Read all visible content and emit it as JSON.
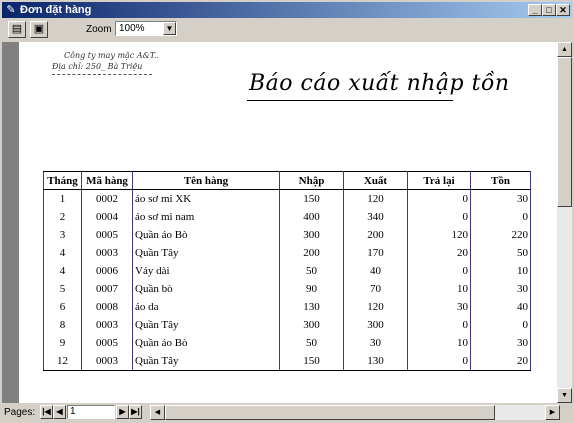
{
  "window": {
    "title": "Đơn đặt hàng",
    "icon": "report-icon"
  },
  "toolbar": {
    "zoom_label": "Zoom",
    "zoom_value": "100%"
  },
  "report": {
    "company": "Công ty may mặc A&T..",
    "address": "Địa chỉ: 250_ Bà Triệu",
    "title": "Báo cáo xuất nhập tồn",
    "columns": [
      "Tháng",
      "Mã hàng",
      "Tên hàng",
      "Nhập",
      "Xuất",
      "Trả lại",
      "Tồn"
    ],
    "rows": [
      [
        "1",
        "0002",
        "áo sơ mi XK",
        "150",
        "120",
        "0",
        "30"
      ],
      [
        "2",
        "0004",
        "áo sơ mi nam",
        "400",
        "340",
        "0",
        "0"
      ],
      [
        "3",
        "0005",
        "Quần áo Bò",
        "300",
        "200",
        "120",
        "220"
      ],
      [
        "4",
        "0003",
        "Quần Tây",
        "200",
        "170",
        "20",
        "50"
      ],
      [
        "4",
        "0006",
        "Váy dài",
        "50",
        "40",
        "0",
        "10"
      ],
      [
        "5",
        "0007",
        "Quần bò",
        "90",
        "70",
        "10",
        "30"
      ],
      [
        "6",
        "0008",
        "áo da",
        "130",
        "120",
        "30",
        "40"
      ],
      [
        "8",
        "0003",
        "Quần Tây",
        "300",
        "300",
        "0",
        "0"
      ],
      [
        "9",
        "0005",
        "Quần áo Bò",
        "50",
        "30",
        "10",
        "30"
      ],
      [
        "12",
        "0003",
        "Quần Tây",
        "150",
        "130",
        "0",
        "20"
      ]
    ]
  },
  "statusbar": {
    "pages_label": "Pages:",
    "page_value": "1"
  }
}
